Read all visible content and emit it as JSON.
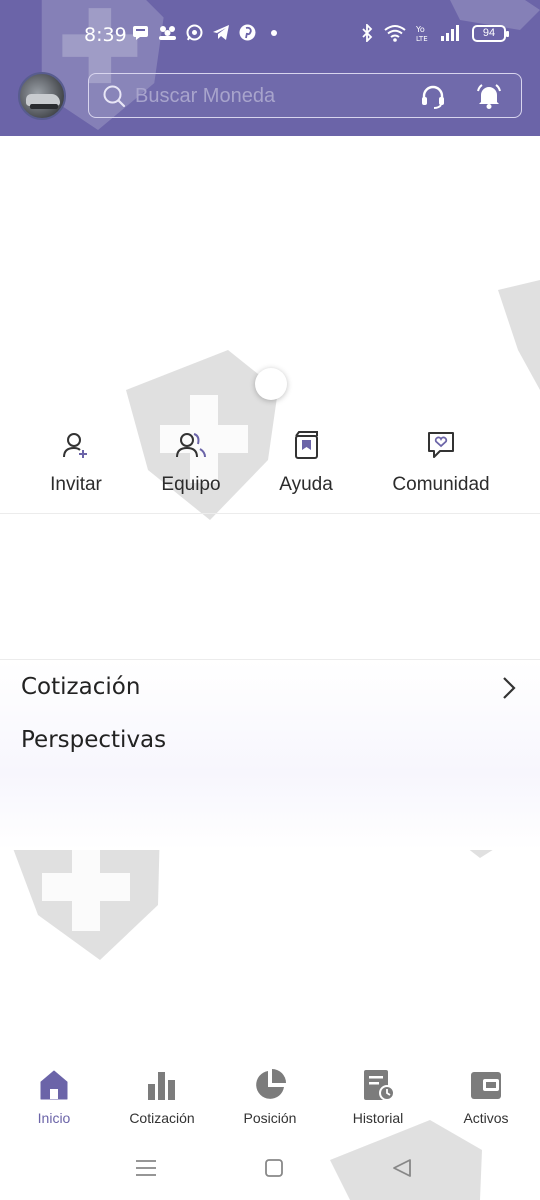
{
  "status_bar": {
    "time": "8:39",
    "battery": "94"
  },
  "header": {
    "search_placeholder": "Buscar Moneda",
    "accent_color": "#6b64a8"
  },
  "quick_actions": [
    {
      "label": "Invitar",
      "icon": "user-add-icon"
    },
    {
      "label": "Equipo",
      "icon": "team-icon"
    },
    {
      "label": "Ayuda",
      "icon": "book-icon"
    },
    {
      "label": "Comunidad",
      "icon": "chat-heart-icon"
    }
  ],
  "sections": {
    "quotes_title": "Cotización",
    "outlook_title": "Perspectivas"
  },
  "bottom_nav": [
    {
      "label": "Inicio",
      "icon": "home-icon",
      "active": true
    },
    {
      "label": "Cotización",
      "icon": "bar-chart-icon",
      "active": false
    },
    {
      "label": "Posición",
      "icon": "pie-chart-icon",
      "active": false
    },
    {
      "label": "Historial",
      "icon": "history-icon",
      "active": false
    },
    {
      "label": "Activos",
      "icon": "wallet-icon",
      "active": false
    }
  ]
}
